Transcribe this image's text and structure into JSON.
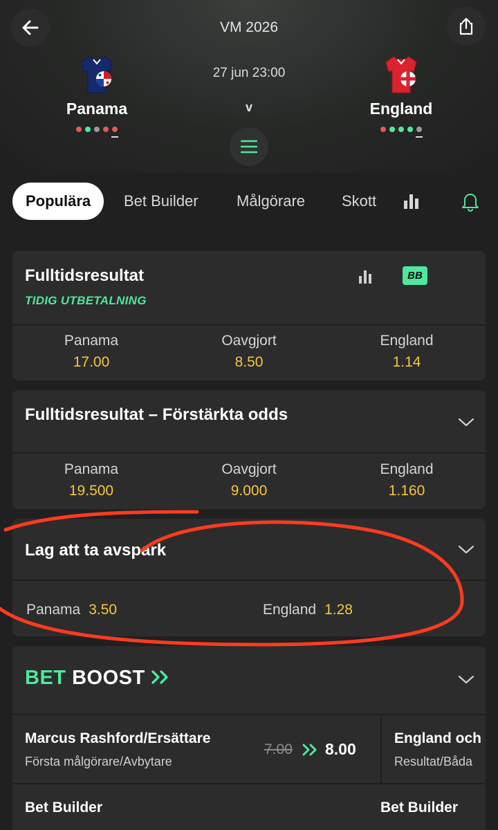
{
  "header": {
    "competition": "VM 2026",
    "datetime": "27 jun 23:00",
    "vs": "v",
    "back_icon": "arrow-left-icon",
    "share_icon": "share-icon",
    "menu_icon": "menu-icon"
  },
  "home": {
    "name": "Panama",
    "kit_icon": "panama-shirt-icon",
    "form": [
      "#e05a5a",
      "#4ee89c",
      "#9a9a9a",
      "#e05a5a",
      "#e05a5a"
    ]
  },
  "away": {
    "name": "England",
    "kit_icon": "england-shirt-icon",
    "form": [
      "#e05a5a",
      "#4ee89c",
      "#4ee89c",
      "#4ee89c",
      "#9a9a9a"
    ]
  },
  "tabs": {
    "popular": "Populära",
    "bet_builder": "Bet Builder",
    "goalscorers": "Målgörare",
    "shots": "Skott",
    "stats_icon": "stats-icon",
    "bell_icon": "bell-icon"
  },
  "markets": {
    "fulltime": {
      "title": "Fulltidsresultat",
      "early_payout": "TIDIG UTBETALNING",
      "badge": "BB",
      "outcomes": [
        {
          "label": "Panama",
          "odds": "17.00"
        },
        {
          "label": "Oavgjort",
          "odds": "8.50"
        },
        {
          "label": "England",
          "odds": "1.14"
        }
      ]
    },
    "boosted": {
      "title": "Fulltidsresultat – Förstärkta odds",
      "outcomes": [
        {
          "label": "Panama",
          "odds": "19.500"
        },
        {
          "label": "Oavgjort",
          "odds": "9.000"
        },
        {
          "label": "England",
          "odds": "1.160"
        }
      ]
    },
    "kickoff": {
      "title": "Lag att ta avspark",
      "outcomes": [
        {
          "label": "Panama",
          "odds": "3.50"
        },
        {
          "label": "England",
          "odds": "1.28"
        }
      ]
    }
  },
  "bet_boost": {
    "title_bet": "BET",
    "title_boost": "BOOST",
    "items": [
      {
        "name": "Marcus Rashford/Ersättare",
        "subtitle": "Första målgörare/Avbytare",
        "old_odds": "7.00",
        "new_odds": "8.00",
        "footer": "Bet Builder"
      },
      {
        "name": "England och",
        "subtitle": "Resultat/Båda",
        "footer": "Bet Builder"
      }
    ]
  },
  "colors": {
    "accent_green": "#4ee89c",
    "odds_yellow": "#f5c642",
    "annotation_red": "#ff3b1f"
  }
}
